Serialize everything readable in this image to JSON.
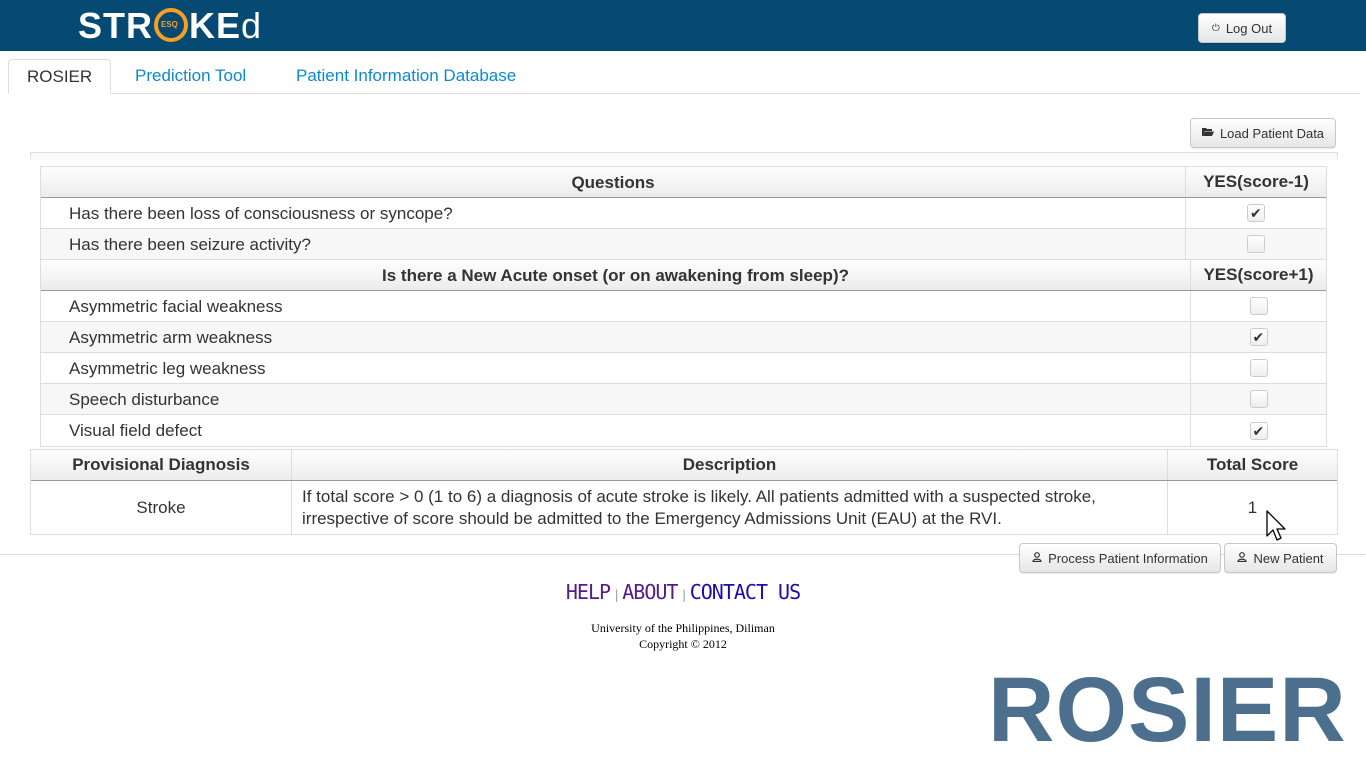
{
  "brand": {
    "logo_text_before": "STR",
    "logo_text_after": "KE",
    "logo_text_tail": "d",
    "logo_emblem_text": "ESQ"
  },
  "header": {
    "logout_label": "Log Out"
  },
  "tabs": [
    {
      "label": "ROSIER",
      "active": true
    },
    {
      "label": "Prediction Tool",
      "active": false
    },
    {
      "label": "Patient Information Database",
      "active": false
    }
  ],
  "toolbar": {
    "load_label": "Load Patient Data"
  },
  "questions_table": {
    "section1": {
      "header_question": "Questions",
      "header_score": "YES(score-1)",
      "rows": [
        {
          "text": "Has there been loss of consciousness or syncope?",
          "checked": true
        },
        {
          "text": "Has there been seizure activity?",
          "checked": false
        }
      ]
    },
    "section2": {
      "header_question": "Is there a New Acute onset (or on awakening from sleep)?",
      "header_score": "YES(score+1)",
      "rows": [
        {
          "text": "Asymmetric facial weakness",
          "checked": false
        },
        {
          "text": "Asymmetric arm weakness",
          "checked": true
        },
        {
          "text": "Asymmetric leg weakness",
          "checked": false
        },
        {
          "text": "Speech disturbance",
          "checked": false
        },
        {
          "text": "Visual field defect",
          "checked": true
        }
      ]
    }
  },
  "diagnosis_table": {
    "headers": [
      "Provisional Diagnosis",
      "Description",
      "Total Score"
    ],
    "diagnosis": "Stroke",
    "description": "If total score > 0 (1 to 6) a diagnosis of acute stroke is likely. All patients admitted with a suspected stroke, irrespective of score should be admitted to the Emergency Admissions Unit (EAU) at the RVI.",
    "total_score": "1"
  },
  "actions": {
    "process_label": "Process Patient Information",
    "new_patient_label": "New Patient"
  },
  "footer": {
    "links": [
      "HELP",
      "ABOUT",
      "CONTACT US"
    ],
    "separator": "|",
    "institution": "University of the Philippines, Diliman",
    "copyright": "Copyright © 2012"
  },
  "watermark": "ROSIER",
  "colors": {
    "topbar": "#064a73",
    "logo_accent": "#f5a020",
    "tab_link": "#0a8ad0",
    "watermark": "#4d6f8e"
  },
  "icons": {
    "logout": "power-icon",
    "load": "folder-open-icon",
    "process": "user-icon",
    "new_patient": "user-icon"
  }
}
